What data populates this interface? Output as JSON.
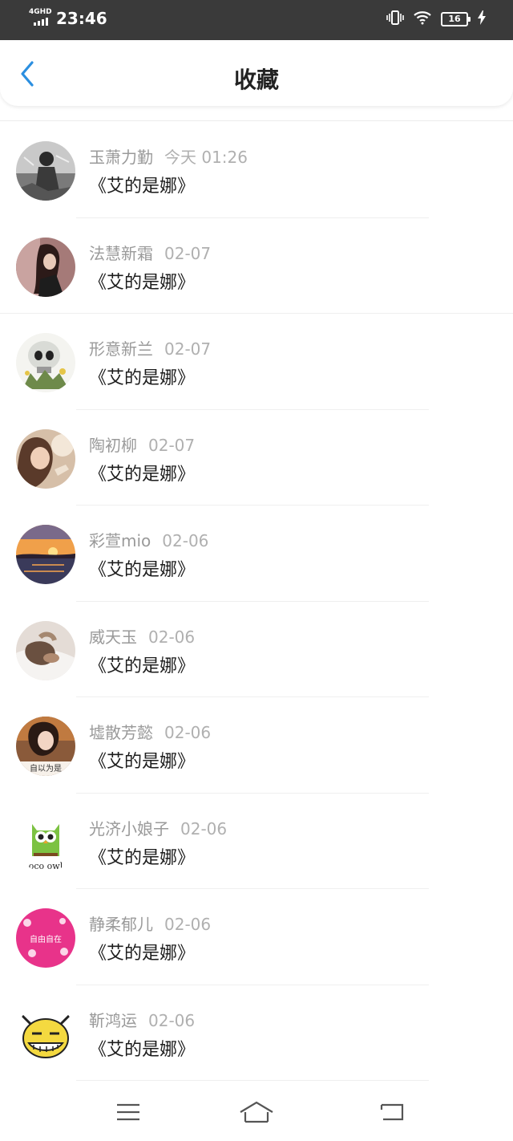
{
  "status_bar": {
    "network": "4GHD",
    "time": "23:46",
    "battery": "16"
  },
  "header": {
    "title": "收藏"
  },
  "items": [
    {
      "user": "玉萧力勤",
      "date": "今天 01:26",
      "title": "《艾的是娜》"
    },
    {
      "user": "法慧新霜",
      "date": "02-07",
      "title": "《艾的是娜》"
    },
    {
      "user": "形意新兰",
      "date": "02-07",
      "title": "《艾的是娜》"
    },
    {
      "user": "陶初柳",
      "date": "02-07",
      "title": "《艾的是娜》"
    },
    {
      "user": "彩萱mio",
      "date": "02-06",
      "title": "《艾的是娜》"
    },
    {
      "user": "威天玉",
      "date": "02-06",
      "title": "《艾的是娜》"
    },
    {
      "user": "墟散芳懿",
      "date": "02-06",
      "title": "《艾的是娜》"
    },
    {
      "user": "光济小娘子",
      "date": "02-06",
      "title": "《艾的是娜》"
    },
    {
      "user": "静柔郁儿",
      "date": "02-06",
      "title": "《艾的是娜》"
    },
    {
      "user": "靳鸿运",
      "date": "02-06",
      "title": "《艾的是娜》"
    }
  ],
  "avatar_text": {
    "owl": "oco owl",
    "item7": "自以为是",
    "item9": "自由自在"
  },
  "colors": {
    "accent": "#2b8fe0",
    "status_bar": "#3a3a3a"
  }
}
